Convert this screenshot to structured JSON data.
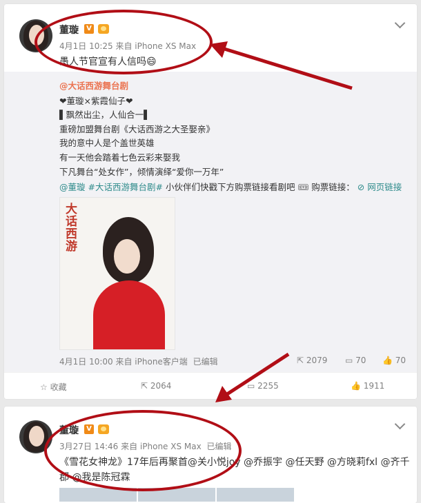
{
  "post1": {
    "name": "董璇",
    "verified_badge": "V",
    "meta": "4月1日 10:25 来自 iPhone XS Max",
    "text": "愚人节官宣有人信吗😄",
    "repost": {
      "author": "@大话西游舞台剧",
      "lines": [
        "❤董璇×紫霞仙子❤",
        "▌飘然出尘，人仙合一▌",
        "重磅加盟舞台剧《大话西游之大圣娶亲》",
        "我的意中人是个盖世英雄",
        "有一天他会踏着七色云彩来娶我",
        "下凡舞台“处女作”，倾情演绎“爱你一万年”"
      ],
      "mention": "@董璇",
      "hashtag": "#大话西游舞台剧#",
      "mid_text": " 小伙伴们快戳下方购票链接看剧吧",
      "ticket_text": "购票链接：",
      "web_link": "网页链接",
      "poster_title": "大话西游",
      "meta": "4月1日 10:00 来自 iPhone客户端",
      "edited": "已编辑",
      "forward_count": "2079",
      "comment_count": "70",
      "like_count": "70"
    },
    "actions": {
      "favorite": "收藏",
      "forward": "2064",
      "comment": "2255",
      "like": "1911"
    }
  },
  "post2": {
    "name": "董璇",
    "verified_badge": "V",
    "meta": "3月27日 14:46 来自 iPhone XS Max",
    "edited": "已编辑",
    "text_line1": "《雪花女神龙》17年后再聚首@关小悦joy @乔振宇 @任天野 @方晓莉fxl @齐千",
    "text_line2": "郡 @我是陈冠霖"
  },
  "annotation_color": "#b10e16"
}
